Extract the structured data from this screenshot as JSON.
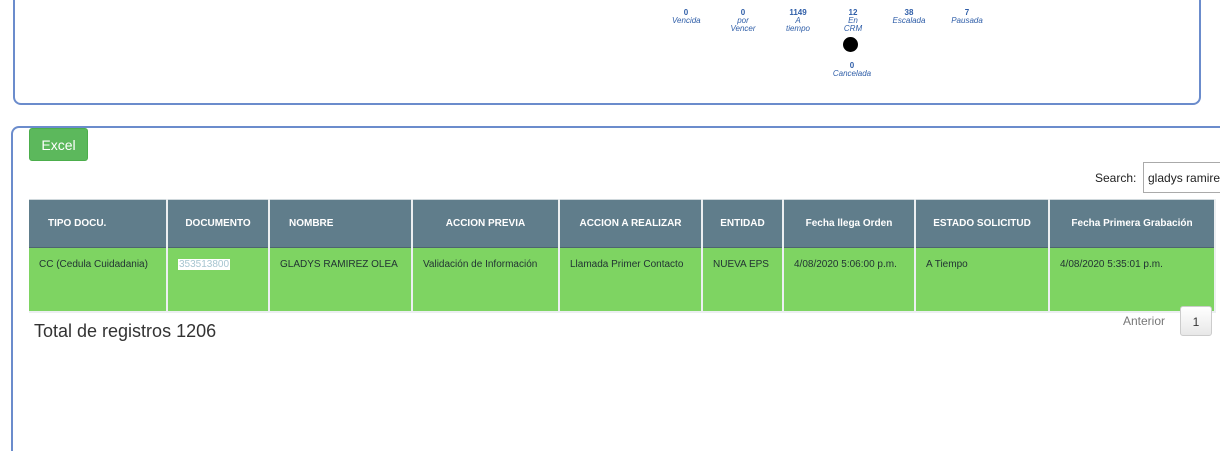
{
  "summary": {
    "vencida": {
      "num": "0",
      "label": "Vencida"
    },
    "por_vencer": {
      "num": "0",
      "label": "por Vencer"
    },
    "a_tiempo": {
      "num": "1149",
      "label": "A tiempo"
    },
    "en_crm": {
      "num": "12",
      "label": "En CRM"
    },
    "escalada": {
      "num": "38",
      "label": "Escalada"
    },
    "pausada": {
      "num": "7",
      "label": "Pausada"
    },
    "cancelada": {
      "num": "0",
      "label": "Cancelada"
    }
  },
  "toolbar": {
    "excel_label": "Excel",
    "search_label": "Search:",
    "search_value": "gladys ramirez"
  },
  "table": {
    "headers": [
      "TIPO DOCU.",
      "DOCUMENTO",
      "NOMBRE",
      "ACCION PREVIA",
      "ACCION A REALIZAR",
      "ENTIDAD",
      "Fecha llega Orden",
      "ESTADO SOLICITUD",
      "Fecha Primera Grabación"
    ],
    "rows": [
      {
        "tipo_docu": "CC (Cedula Cuidadania)",
        "documento": "353513800",
        "nombre": "GLADYS RAMIREZ OLEA",
        "accion_previa": "Validación de Información",
        "accion_a_realizar": "Llamada Primer Contacto",
        "entidad": "NUEVA EPS",
        "fecha_llega_orden": "4/08/2020 5:06:00 p.m.",
        "estado_solicitud": "A Tiempo",
        "fecha_primera_grabacion": "4/08/2020 5:35:01 p.m."
      }
    ]
  },
  "footer": {
    "total_label": "Total de registros 1206",
    "prev_label": "Anterior",
    "current_page": "1"
  },
  "colors": {
    "header_bg": "#607d8b",
    "row_bg": "#7ed462",
    "excel_btn": "#5cb85c",
    "panel_border": "#6b8ccc"
  }
}
